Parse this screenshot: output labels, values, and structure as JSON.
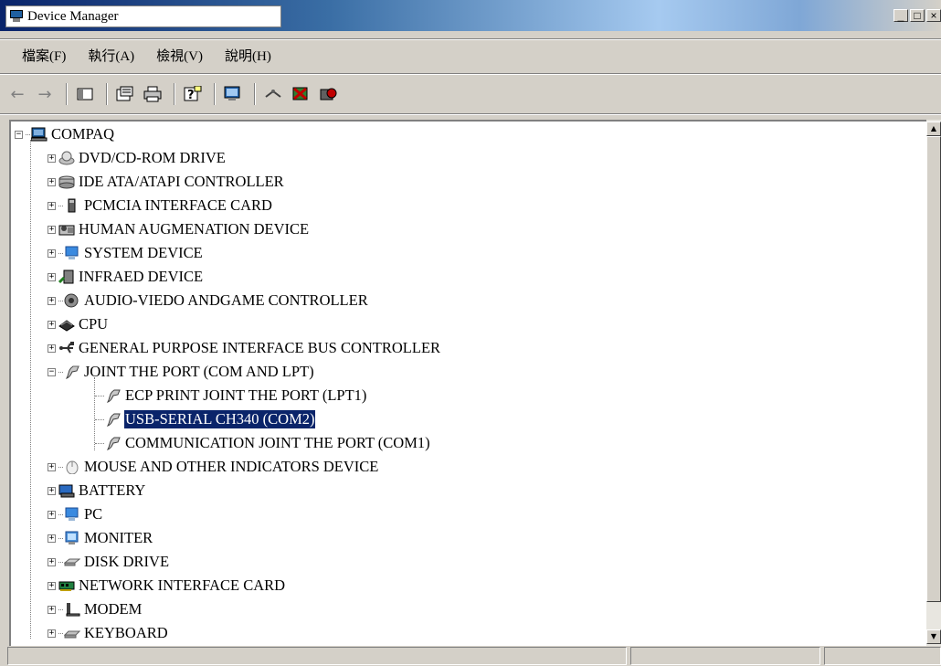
{
  "window": {
    "title": "Device Manager",
    "buttons": [
      "_",
      "□",
      "×"
    ]
  },
  "menu": [
    "檔案(F)",
    "執行(A)",
    "檢視(V)",
    "說明(H)"
  ],
  "toolbar": [
    "back-icon",
    "forward-icon",
    "console-tree-icon",
    "properties-icon",
    "print-icon",
    "help-icon",
    "scan-hardware-icon",
    "update-driver-icon",
    "uninstall-icon",
    "disable-icon"
  ],
  "tree": {
    "root": "COMPAQ",
    "items": [
      {
        "label": "DVD/CD-ROM DRIVE",
        "icon": "cdrom-icon",
        "expand": "+"
      },
      {
        "label": "IDE ATA/ATAPI CONTROLLER",
        "icon": "ide-controller-icon",
        "expand": "+"
      },
      {
        "label": "PCMCIA INTERFACE CARD",
        "icon": "pcmcia-icon",
        "expand": "+"
      },
      {
        "label": "HUMAN AUGMENATION DEVICE",
        "icon": "hid-icon",
        "expand": "+"
      },
      {
        "label": "SYSTEM DEVICE",
        "icon": "system-device-icon",
        "expand": "+"
      },
      {
        "label": "INFRAED DEVICE",
        "icon": "infrared-icon",
        "expand": "+"
      },
      {
        "label": "AUDIO-VIEDO ANDGAME CONTROLLER",
        "icon": "audio-icon",
        "expand": "+"
      },
      {
        "label": "CPU",
        "icon": "cpu-icon",
        "expand": "+"
      },
      {
        "label": "GENERAL PURPOSE INTERFACE BUS CONTROLLER",
        "icon": "usb-icon",
        "expand": "+"
      },
      {
        "label": "JOINT THE PORT (COM AND LPT)",
        "icon": "port-icon",
        "expand": "−",
        "children": [
          {
            "label": "ECP PRINT JOINT THE PORT (LPT1)",
            "icon": "port-icon"
          },
          {
            "label": "USB-SERIAL CH340 (COM2)",
            "icon": "port-icon",
            "selected": true
          },
          {
            "label": "COMMUNICATION JOINT THE PORT (COM1)",
            "icon": "port-icon"
          }
        ]
      },
      {
        "label": "MOUSE AND OTHER INDICATORS DEVICE",
        "icon": "mouse-icon",
        "expand": "+"
      },
      {
        "label": "BATTERY",
        "icon": "battery-icon",
        "expand": "+"
      },
      {
        "label": "PC",
        "icon": "computer-icon",
        "expand": "+"
      },
      {
        "label": "MONITER",
        "icon": "monitor-icon",
        "expand": "+"
      },
      {
        "label": "DISK DRIVE",
        "icon": "disk-drive-icon",
        "expand": "+"
      },
      {
        "label": "NETWORK INTERFACE CARD",
        "icon": "network-card-icon",
        "expand": "+"
      },
      {
        "label": "MODEM",
        "icon": "modem-icon",
        "expand": "+"
      },
      {
        "label": "KEYBOARD",
        "icon": "keyboard-icon",
        "expand": "+"
      }
    ]
  },
  "colors": {
    "selection": "#0a246a",
    "face": "#d4d0c8"
  }
}
